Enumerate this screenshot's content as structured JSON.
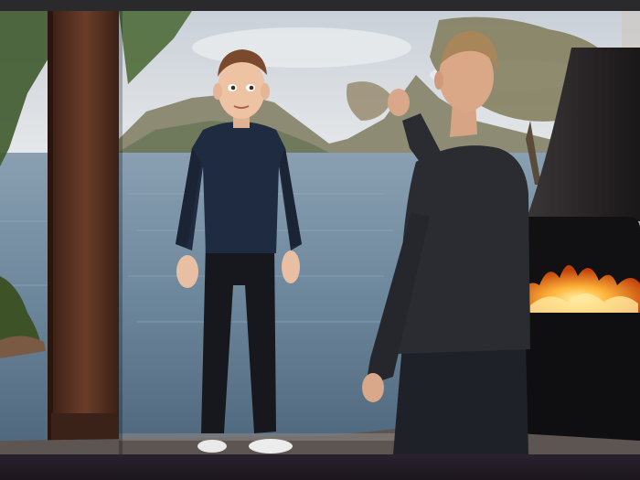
{
  "scene": {
    "subjects": [
      "cartoon-avatar",
      "man-in-dark-sweater"
    ],
    "setting": "lakeside-room-with-fireplace"
  },
  "colors": {
    "sky": "#cfd6de",
    "water": "#6f8aa0",
    "hills": "#8c8a6e",
    "wood_post": "#5a3424",
    "sweater": "#1f2a3d",
    "pants": "#15161a",
    "fire": "#ff9a2a",
    "fireplace": "#141416"
  }
}
